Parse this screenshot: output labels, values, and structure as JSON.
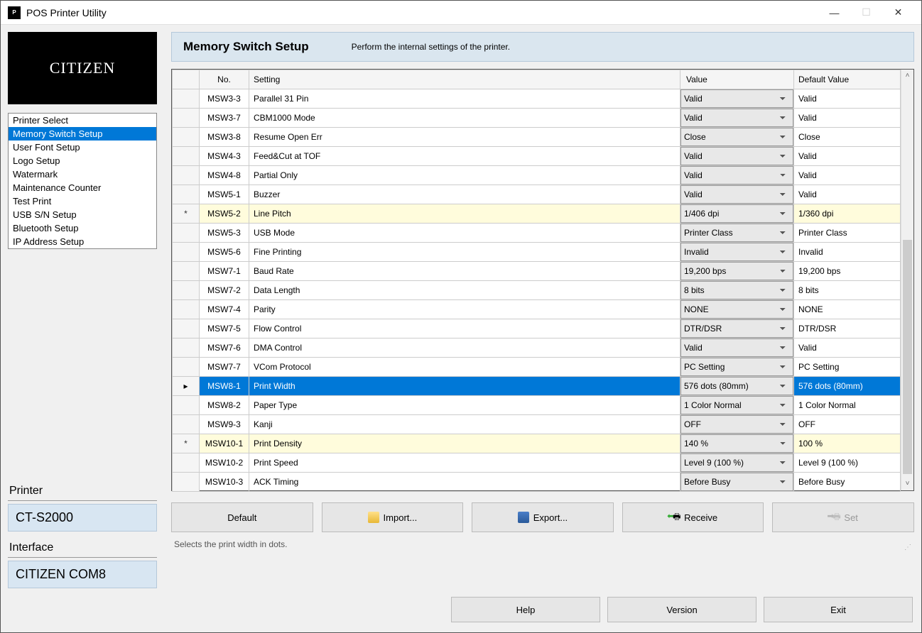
{
  "window": {
    "title": "POS Printer Utility"
  },
  "brand": "CITIZEN",
  "nav": {
    "items": [
      "Printer Select",
      "Memory Switch Setup",
      "User Font Setup",
      "Logo Setup",
      "Watermark",
      "Maintenance Counter",
      "Test Print",
      "USB S/N Setup",
      "Bluetooth Setup",
      "IP Address Setup"
    ],
    "selected_index": 1
  },
  "printer": {
    "label": "Printer",
    "value": "CT-S2000"
  },
  "interface": {
    "label": "Interface",
    "value": "CITIZEN COM8"
  },
  "panel": {
    "title": "Memory Switch Setup",
    "desc": "Perform the internal settings of the printer."
  },
  "columns": {
    "no": "No.",
    "setting": "Setting",
    "value": "Value",
    "default": "Default Value"
  },
  "rows": [
    {
      "no": "MSW3-3",
      "setting": "Parallel 31 Pin",
      "value": "Valid",
      "default": "Valid"
    },
    {
      "no": "MSW3-7",
      "setting": "CBM1000 Mode",
      "value": "Valid",
      "default": "Valid"
    },
    {
      "no": "MSW3-8",
      "setting": "Resume Open Err",
      "value": "Close",
      "default": "Close"
    },
    {
      "no": "MSW4-3",
      "setting": "Feed&Cut at TOF",
      "value": "Valid",
      "default": "Valid"
    },
    {
      "no": "MSW4-8",
      "setting": "Partial Only",
      "value": "Valid",
      "default": "Valid"
    },
    {
      "no": "MSW5-1",
      "setting": "Buzzer",
      "value": "Valid",
      "default": "Valid"
    },
    {
      "no": "MSW5-2",
      "setting": "Line Pitch",
      "value": "1/406 dpi",
      "default": "1/360 dpi",
      "modified": true
    },
    {
      "no": "MSW5-3",
      "setting": "USB Mode",
      "value": "Printer Class",
      "default": "Printer Class"
    },
    {
      "no": "MSW5-6",
      "setting": "Fine Printing",
      "value": "Invalid",
      "default": "Invalid"
    },
    {
      "no": "MSW7-1",
      "setting": "Baud Rate",
      "value": "19,200 bps",
      "default": "19,200 bps"
    },
    {
      "no": "MSW7-2",
      "setting": "Data Length",
      "value": "8 bits",
      "default": "8 bits"
    },
    {
      "no": "MSW7-4",
      "setting": "Parity",
      "value": "NONE",
      "default": "NONE"
    },
    {
      "no": "MSW7-5",
      "setting": "Flow Control",
      "value": "DTR/DSR",
      "default": "DTR/DSR"
    },
    {
      "no": "MSW7-6",
      "setting": "DMA Control",
      "value": "Valid",
      "default": "Valid"
    },
    {
      "no": "MSW7-7",
      "setting": "VCom Protocol",
      "value": "PC Setting",
      "default": "PC Setting"
    },
    {
      "no": "MSW8-1",
      "setting": "Print Width",
      "value": "576 dots (80mm)",
      "default": "576 dots (80mm)",
      "selected": true
    },
    {
      "no": "MSW8-2",
      "setting": "Paper Type",
      "value": "1 Color Normal",
      "default": "1 Color Normal"
    },
    {
      "no": "MSW9-3",
      "setting": "Kanji",
      "value": "OFF",
      "default": "OFF"
    },
    {
      "no": "MSW10-1",
      "setting": "Print Density",
      "value": "140 %",
      "default": "100 %",
      "modified": true
    },
    {
      "no": "MSW10-2",
      "setting": "Print Speed",
      "value": "Level 9 (100 %)",
      "default": "Level 9 (100 %)"
    },
    {
      "no": "MSW10-3",
      "setting": "ACK Timing",
      "value": "Before Busy",
      "default": "Before Busy"
    }
  ],
  "buttons": {
    "default": "Default",
    "import": "Import...",
    "export": "Export...",
    "receive": "Receive",
    "set": "Set"
  },
  "status": "Selects the print width in dots.",
  "footer": {
    "help": "Help",
    "version": "Version",
    "exit": "Exit"
  }
}
